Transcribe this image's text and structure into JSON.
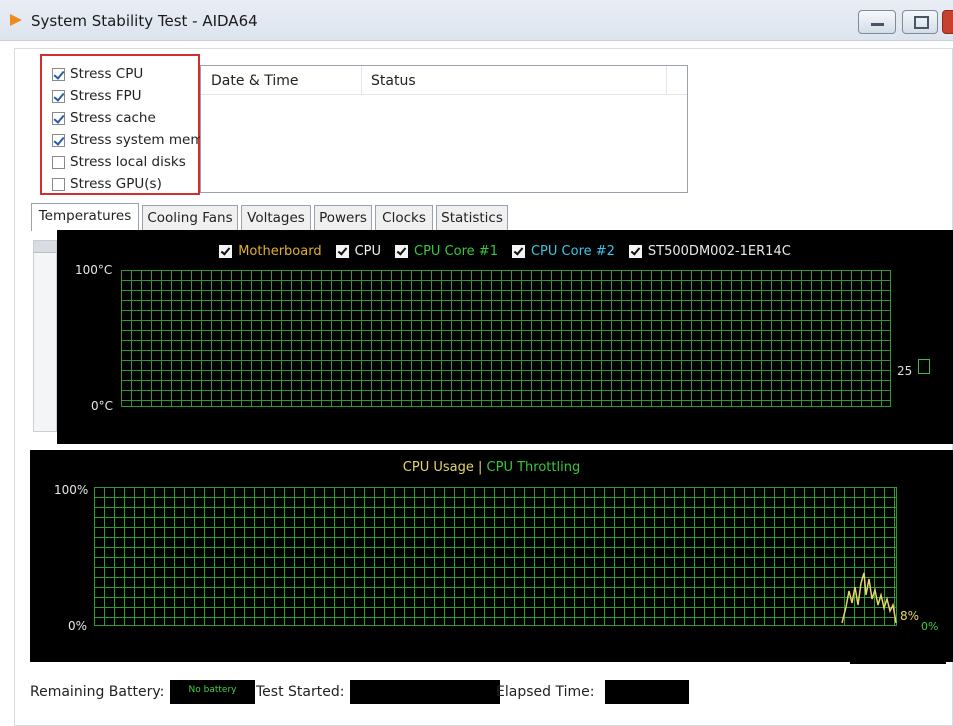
{
  "window": {
    "title": "System Stability Test - AIDA64"
  },
  "stress_options": [
    {
      "label": "Stress CPU",
      "checked": true
    },
    {
      "label": "Stress FPU",
      "checked": true
    },
    {
      "label": "Stress cache",
      "checked": true
    },
    {
      "label": "Stress system mem",
      "checked": true
    },
    {
      "label": "Stress local disks",
      "checked": false
    },
    {
      "label": "Stress GPU(s)",
      "checked": false
    }
  ],
  "log": {
    "columns": [
      "Date & Time",
      "Status"
    ]
  },
  "tabs": [
    {
      "label": "Temperatures",
      "active": true
    },
    {
      "label": "Cooling Fans",
      "active": false
    },
    {
      "label": "Voltages",
      "active": false
    },
    {
      "label": "Powers",
      "active": false
    },
    {
      "label": "Clocks",
      "active": false
    },
    {
      "label": "Statistics",
      "active": false
    }
  ],
  "temperature_chart": {
    "legend": [
      {
        "label": "Motherboard",
        "color": "#e0b030"
      },
      {
        "label": "CPU",
        "color": "#f0f0f0"
      },
      {
        "label": "CPU Core #1",
        "color": "#38c83c"
      },
      {
        "label": "CPU Core #2",
        "color": "#3ac6e8"
      },
      {
        "label": "ST500DM002-1ER14C",
        "color": "#e8e8e8"
      }
    ],
    "y_max_label": "100°C",
    "y_min_label": "0°C",
    "current_value": "25"
  },
  "cpu_chart": {
    "title_usage": "CPU Usage",
    "separator": "|",
    "title_throttling": "CPU Throttling",
    "usage_color": "#e6d56a",
    "throttling_color": "#38c83c",
    "y_max_label": "100%",
    "y_min_label": "0%",
    "usage_readout": "8%",
    "throttling_readout": "0%"
  },
  "status": {
    "remaining_battery_label": "Remaining Battery:",
    "battery_value": "No battery",
    "test_started_label": "Test Started:",
    "elapsed_time_label": "Elapsed Time:"
  }
}
